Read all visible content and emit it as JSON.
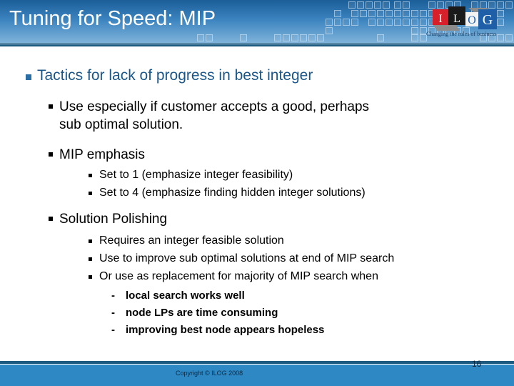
{
  "slide": {
    "title": "Tuning for Speed: MIP",
    "logo": {
      "letters": [
        "I",
        "L",
        "O",
        "G"
      ],
      "tagline": "Changing the rules of business",
      "colors": {
        "red": "#d8202a",
        "black": "#1a1a1a",
        "blue": "#1e5fa8",
        "grey": "#8c8c8c"
      }
    },
    "bullets": {
      "main": "Tactics for lack of progress in best integer",
      "use_especially_line1": "Use especially if customer accepts a good, perhaps",
      "use_especially_line2": "sub optimal solution.",
      "mip_emphasis": {
        "label": "MIP emphasis",
        "items": [
          "Set to 1 (emphasize integer feasibility)",
          "Set to 4 (emphasize finding hidden integer solutions)"
        ]
      },
      "solution_polishing": {
        "label": "Solution Polishing",
        "items": [
          "Requires an integer feasible solution",
          "Use to improve sub optimal solutions at end of MIP search",
          "Or use as replacement for majority of MIP search when"
        ],
        "conditions": [
          "local search works well",
          "node LPs are time consuming",
          "improving best node appears hopeless"
        ],
        "dash": "-"
      }
    },
    "footer": {
      "copyright": "Copyright © ILOG 2008",
      "page_number": "16"
    },
    "colors": {
      "header_dark": "#1b5e98",
      "header_light": "#7fb3da",
      "accent_text": "#1a5689",
      "footer": "#2d88c4",
      "rule": "#1c5a80"
    }
  }
}
